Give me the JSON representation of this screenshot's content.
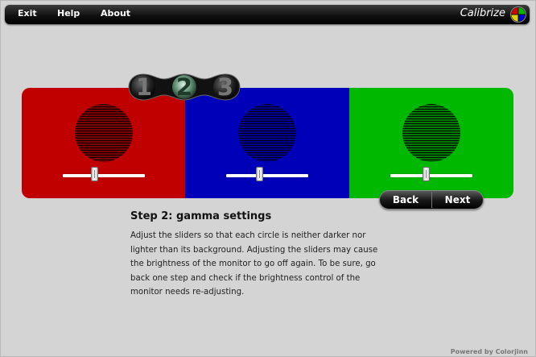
{
  "menu": {
    "exit": "Exit",
    "help": "Help",
    "about": "About",
    "brand": "Calibrize"
  },
  "steps": {
    "one": "1",
    "two": "2",
    "three": "3",
    "active": 2
  },
  "colors": {
    "red": "#c00000",
    "blue": "#0000b8",
    "green": "#00b800",
    "red_circle": "#7a0000",
    "blue_circle": "#000090",
    "green_circle": "#007a00"
  },
  "sliders": {
    "red": 0.4,
    "blue": 0.41,
    "green": 0.44
  },
  "nav": {
    "back": "Back",
    "next": "Next"
  },
  "content": {
    "title": "Step 2: gamma settings",
    "lines": [
      "Adjust the sliders so that each circle is neither darker nor",
      "lighter than its background. Adjusting the sliders may cause",
      "the brightness of the monitor to go off again. To be sure, go",
      "back one step and check if the brightness control of the",
      "monitor needs re-adjusting."
    ]
  },
  "footer": "Powered by Colorjinn"
}
